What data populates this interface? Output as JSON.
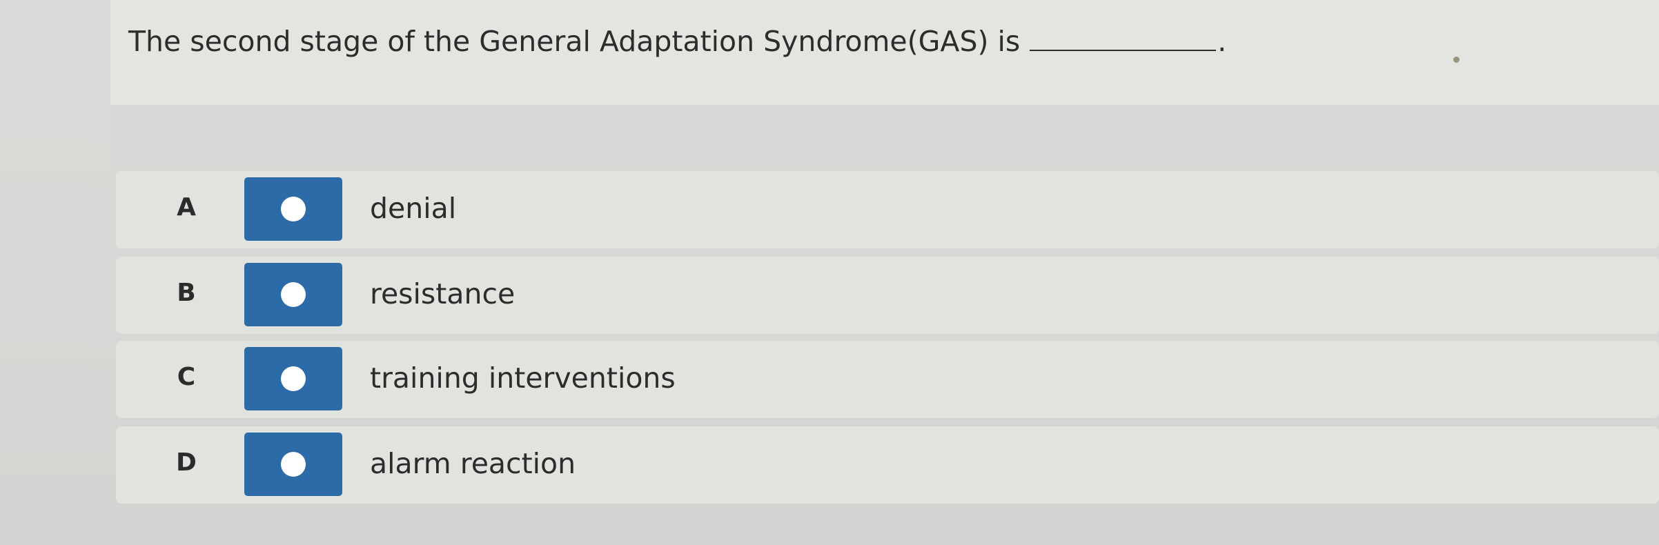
{
  "question": {
    "text": "The second stage of the General Adaptation Syndrome(GAS) is",
    "end_punct": "."
  },
  "options": [
    {
      "letter": "A",
      "text": "denial",
      "selected": false
    },
    {
      "letter": "B",
      "text": "resistance",
      "selected": false
    },
    {
      "letter": "C",
      "text": "training interventions",
      "selected": false
    },
    {
      "letter": "D",
      "text": "alarm reaction",
      "selected": false
    }
  ],
  "colors": {
    "radio_button": "#2d6aa8",
    "radio_dot": "#ffffff"
  }
}
